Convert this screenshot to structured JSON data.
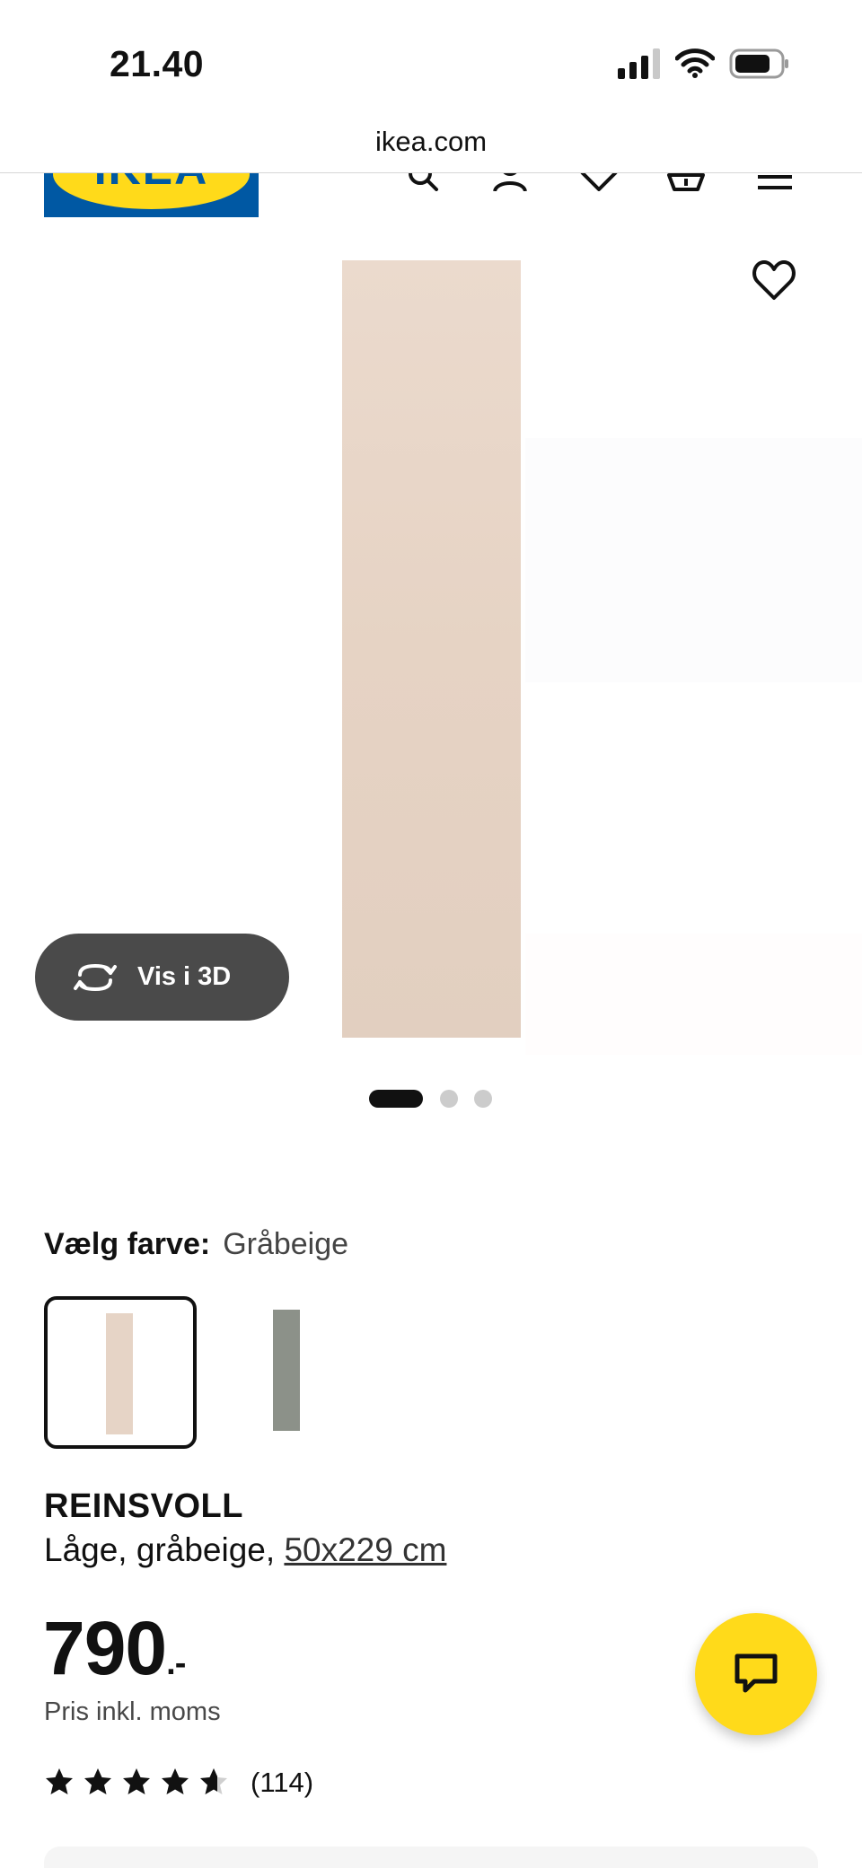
{
  "status_bar": {
    "time": "21.40",
    "icons": [
      "signal-icon",
      "wifi-icon",
      "battery-icon"
    ]
  },
  "browser": {
    "url": "ikea.com"
  },
  "header": {
    "logo_text": "IKEA",
    "brand_colors": {
      "blue": "#0058a3",
      "yellow": "#ffda1a"
    },
    "icons": [
      "search-icon",
      "account-icon",
      "wishlist-icon",
      "cart-icon",
      "menu-icon"
    ]
  },
  "gallery": {
    "view_3d_label": "Vis i 3D",
    "image_count": 3,
    "active_index": 0,
    "favorite_icon": "heart-icon"
  },
  "color_selection": {
    "label": "Vælg farve:",
    "selected_value": "Gråbeige",
    "swatches": [
      {
        "color": "#e6d4c6",
        "selected": true
      },
      {
        "color": "#8c9189",
        "selected": false
      }
    ]
  },
  "product": {
    "name": "REINSVOLL",
    "description": "Låge, gråbeige, ",
    "size_link": "50x229 cm",
    "price": "790",
    "price_suffix": ".-",
    "price_note": "Pris inkl. moms",
    "rating_value": 4.6,
    "rating_max": 5,
    "review_count": "(114)"
  },
  "chat": {
    "icon": "chat-icon",
    "color": "#ffda1a"
  }
}
